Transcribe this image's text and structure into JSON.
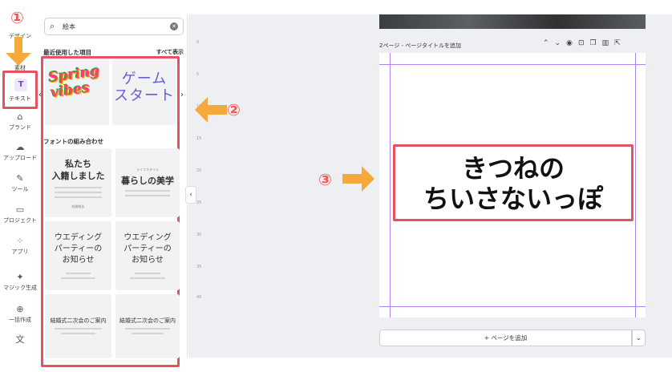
{
  "rail": {
    "items": [
      {
        "label": "デザイン",
        "icon": "design-icon"
      },
      {
        "label": "素材",
        "icon": "elements-icon"
      },
      {
        "label": "テキスト",
        "icon": "text-icon"
      },
      {
        "label": "ブランド",
        "icon": "brand-icon"
      },
      {
        "label": "アップロード",
        "icon": "upload-icon"
      },
      {
        "label": "ツール",
        "icon": "draw-icon"
      },
      {
        "label": "プロジェクト",
        "icon": "folder-icon"
      },
      {
        "label": "アプリ",
        "icon": "apps-icon"
      },
      {
        "label": "マジック生成",
        "icon": "magic-icon"
      },
      {
        "label": "一括作成",
        "icon": "bulk-create-icon"
      }
    ]
  },
  "search": {
    "value": "絵本"
  },
  "panel": {
    "recent_title": "最近使用した項目",
    "see_all": "すべて表示",
    "font_combos_title": "フォントの組み合わせ",
    "recent": [
      {
        "text_line1": "Spring",
        "text_line2": "vibes"
      },
      {
        "text_line1": "ゲーム",
        "text_line2": "スタート"
      }
    ],
    "combos": [
      {
        "line1": "私たち",
        "line2": "入籍しました",
        "small": "結婚報告"
      },
      {
        "line1": "暮らしの美学",
        "small": "ライフスタイル"
      },
      {
        "line1": "ウエディング",
        "line2": "パーティーの",
        "line3": "お知らせ"
      },
      {
        "line1": "ウエディング",
        "line2": "パーティーの",
        "line3": "お知らせ"
      },
      {
        "line1": "結婚式二次会のご案内"
      },
      {
        "line1": "結婚式二次会のご案内"
      }
    ]
  },
  "ruler": {
    "marks": [
      "0",
      "5",
      "10",
      "15",
      "20",
      "25",
      "30",
      "35",
      "40"
    ]
  },
  "page": {
    "header": "2ページ - ページタイトルを追加",
    "title_line1": "きつねの",
    "title_line2": "ちいさないっぽ"
  },
  "add_page": {
    "label": "+ ページを追加"
  },
  "annotations": {
    "badge1": "①",
    "badge2": "②",
    "badge3": "③"
  },
  "colors": {
    "annotation_red": "#e8515f",
    "arrow_orange": "#f5a93a",
    "guide_purple": "#b084f5",
    "accent": "#7b3fe4"
  }
}
